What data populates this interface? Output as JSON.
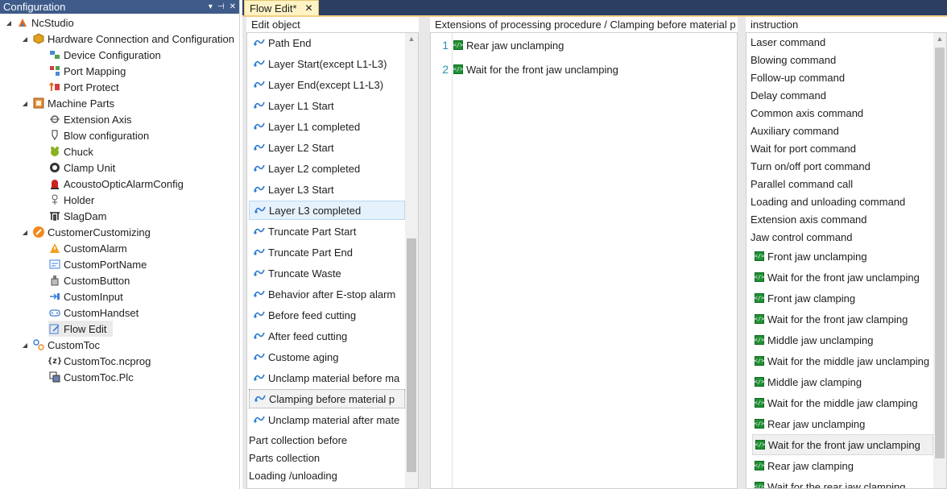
{
  "config_panel": {
    "title": "Configuration",
    "header_buttons": [
      "▾",
      "⊣",
      "✕"
    ],
    "tree": [
      {
        "label": "NcStudio",
        "icon": "ncstudio-icon"
      },
      {
        "label": "Hardware Connection and Configuration",
        "icon": "hexagon-icon"
      },
      {
        "label": "Device Configuration",
        "icon": "device-icon"
      },
      {
        "label": "Port Mapping",
        "icon": "port-mapping-icon"
      },
      {
        "label": "Port Protect",
        "icon": "port-protect-icon"
      },
      {
        "label": "Machine Parts",
        "icon": "machine-parts-icon"
      },
      {
        "label": "Extension Axis",
        "icon": "extension-axis-icon"
      },
      {
        "label": "Blow configuration",
        "icon": "blow-icon"
      },
      {
        "label": "Chuck",
        "icon": "chuck-icon"
      },
      {
        "label": "Clamp Unit",
        "icon": "clamp-unit-icon"
      },
      {
        "label": "AcoustoOpticAlarmConfig",
        "icon": "alarm-light-icon"
      },
      {
        "label": "Holder",
        "icon": "holder-icon"
      },
      {
        "label": "SlagDam",
        "icon": "slagdam-icon"
      },
      {
        "label": "CustomerCustomizing",
        "icon": "customizing-icon"
      },
      {
        "label": "CustomAlarm",
        "icon": "warning-icon"
      },
      {
        "label": "CustomPortName",
        "icon": "port-name-icon"
      },
      {
        "label": "CustomButton",
        "icon": "button-icon"
      },
      {
        "label": "CustomInput",
        "icon": "input-icon"
      },
      {
        "label": "CustomHandset",
        "icon": "handset-icon"
      },
      {
        "label": "Flow Edit",
        "icon": "edit-icon"
      },
      {
        "label": "CustomToc",
        "icon": "toc-icon"
      },
      {
        "label": "CustomToc.ncprog",
        "icon": "ncprog-icon"
      },
      {
        "label": "CustomToc.Plc",
        "icon": "plc-icon"
      }
    ]
  },
  "tab": {
    "label": "Flow Edit*",
    "close": "✕"
  },
  "edit_object": {
    "title": "Edit object",
    "items": [
      "Path End",
      "Layer Start(except L1-L3)",
      "Layer End(except L1-L3)",
      "Layer L1 Start",
      "Layer L1 completed",
      "Layer L2 Start",
      "Layer L2 completed",
      "Layer L3 Start",
      "Layer L3 completed",
      "Truncate Part Start",
      "Truncate Part End",
      "Truncate Waste",
      "Behavior after E-stop alarm",
      "Before feed cutting",
      "After feed cutting",
      "Custome aging",
      "Unclamp material before ma",
      "Clamping before material p",
      "Unclamp material after mate",
      "Part collection before",
      "Parts collection",
      "Loading /unloading"
    ]
  },
  "processing": {
    "title": "Extensions of processing procedure / Clamping before material p",
    "lines": [
      {
        "no": "1",
        "text": "Rear jaw unclamping"
      },
      {
        "no": "2",
        "text": "Wait for the front jaw unclamping"
      }
    ]
  },
  "instruction": {
    "title": "instruction",
    "items": [
      "Laser command",
      "Blowing command",
      "Follow-up command",
      "Delay command",
      "Common axis command",
      "Auxiliary command",
      "Wait for port command",
      "Turn on/off port command",
      "Parallel command call",
      "Loading and unloading command",
      "Extension axis command",
      "Jaw control command"
    ],
    "children": [
      "Front jaw unclamping",
      "Wait for the front jaw unclamping",
      "Front jaw clamping",
      "Wait for the front jaw clamping",
      "Middle jaw unclamping",
      "Wait for the middle jaw unclamping",
      "Middle jaw clamping",
      "Wait for the middle jaw clamping",
      "Rear jaw unclamping",
      "Wait for the front jaw unclamping",
      "Rear jaw clamping",
      "Wait for the rear jaw clamping"
    ]
  }
}
